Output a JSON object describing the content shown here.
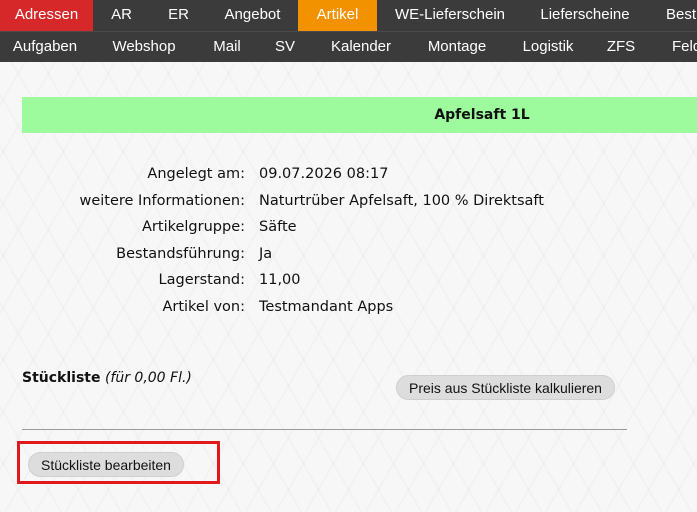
{
  "nav": {
    "row1": [
      {
        "label": "Adressen"
      },
      {
        "label": "AR"
      },
      {
        "label": "ER"
      },
      {
        "label": "Angebot"
      },
      {
        "label": "Artikel"
      },
      {
        "label": "WE-Lieferschein"
      },
      {
        "label": "Lieferscheine"
      },
      {
        "label": "Best"
      }
    ],
    "row2": [
      {
        "label": "Aufgaben"
      },
      {
        "label": "Webshop"
      },
      {
        "label": "Mail"
      },
      {
        "label": "SV"
      },
      {
        "label": "Kalender"
      },
      {
        "label": "Montage"
      },
      {
        "label": "Logistik"
      },
      {
        "label": "ZFS"
      },
      {
        "label": "Feld"
      }
    ],
    "colors": {
      "bar": "#3b3b3b",
      "adressen": "#d62828",
      "artikel_active": "#f39200"
    }
  },
  "article": {
    "title": "Apfelsaft 1L",
    "title_bg": "#9dfb9d",
    "fields": [
      {
        "label": "Angelegt am:",
        "value": "09.07.2026 08:17"
      },
      {
        "label": "weitere Informationen:",
        "value": "Naturtrüber Apfelsaft, 100 % Direktsaft"
      },
      {
        "label": "Artikelgruppe:",
        "value": "Säfte"
      },
      {
        "label": "Bestandsführung:",
        "value": "Ja"
      },
      {
        "label": "Lagerstand:",
        "value": "11,00"
      },
      {
        "label": "Artikel von:",
        "value": "Testmandant Apps"
      }
    ]
  },
  "stueckliste": {
    "title": "Stückliste",
    "subtitle": "(für 0,00 Fl.)",
    "calc_button": "Preis aus Stückliste kalkulieren",
    "edit_button": "Stückliste bearbeiten",
    "highlight_color": "#e01a1a"
  }
}
